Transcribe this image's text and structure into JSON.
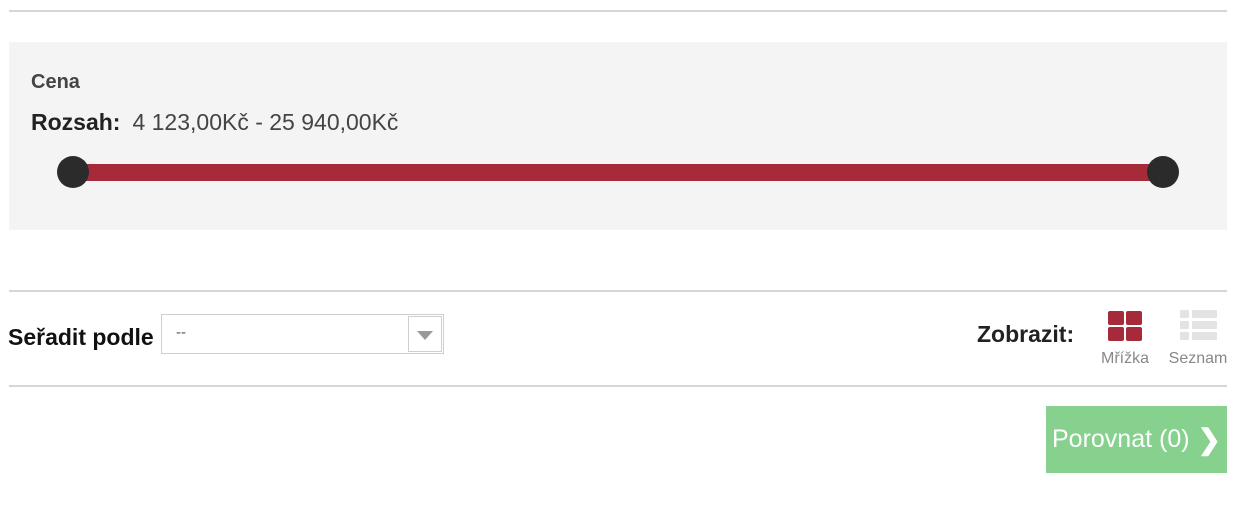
{
  "price_filter": {
    "title": "Cena",
    "range_label": "Rozsah:",
    "range_value": "4 123,00Kč - 25 940,00Kč",
    "slider": {
      "min": 4123,
      "max": 25940,
      "selected_min": 4123,
      "selected_max": 25940,
      "fill_color": "#a72a3a",
      "handle_color": "#2b2b2b"
    }
  },
  "toolbar": {
    "sort_label": "Seřadit podle",
    "sort_selected": "--",
    "view_label": "Zobrazit:",
    "view_options": [
      {
        "label": "Mřížka",
        "icon": "grid-icon",
        "active": true
      },
      {
        "label": "Seznam",
        "icon": "list-icon",
        "active": false
      }
    ]
  },
  "compare": {
    "label": "Porovnat (0)",
    "icon": "chevron-right-icon",
    "color": "#86d18d"
  }
}
